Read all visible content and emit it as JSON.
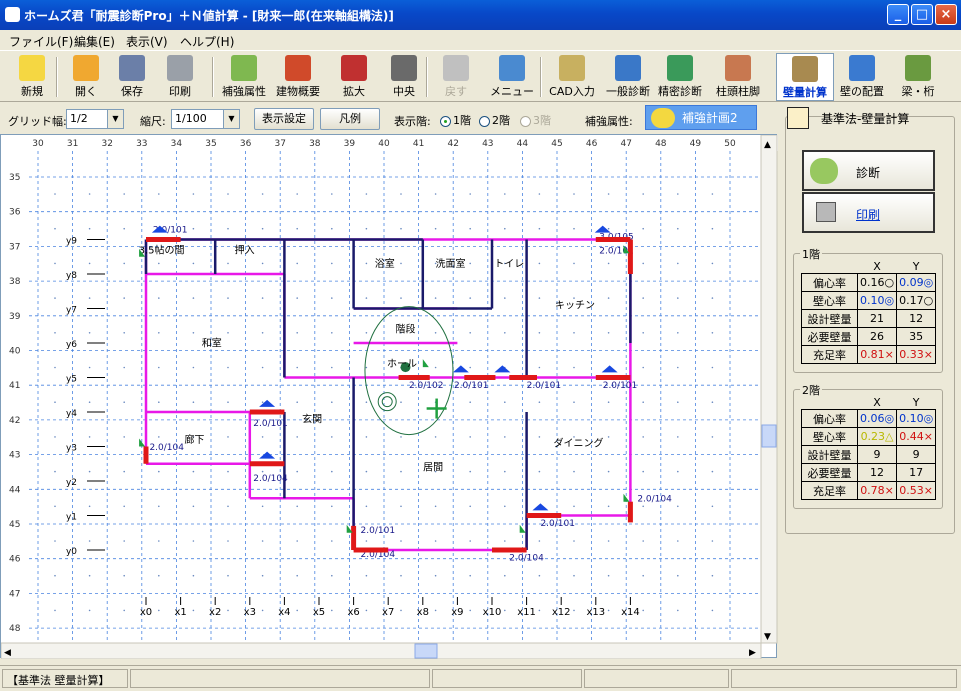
{
  "window": {
    "title": "ホームズ君「耐震診断Pro」＋Ｎ値計算 - [財来一郎(在来軸組構法)]"
  },
  "menu": [
    "ファイル(F)",
    "編集(E)",
    "表示(V)",
    "ヘルプ(H)"
  ],
  "toolbar": [
    {
      "label": "新規",
      "icon": "new-icon"
    },
    {
      "label": "開く",
      "icon": "open-folder-icon"
    },
    {
      "label": "保存",
      "icon": "save-icon"
    },
    {
      "label": "印刷",
      "icon": "print-icon"
    },
    {
      "label": "補強属性",
      "icon": "reinforce-icon"
    },
    {
      "label": "建物概要",
      "icon": "house-icon"
    },
    {
      "label": "拡大",
      "icon": "zoom-in-icon"
    },
    {
      "label": "中央",
      "icon": "center-icon"
    },
    {
      "label": "戻す",
      "icon": "undo-icon"
    },
    {
      "label": "メニュー",
      "icon": "menu-door-icon"
    },
    {
      "label": "CAD入力",
      "icon": "cad-icon"
    },
    {
      "label": "一般診断",
      "icon": "general-diagnosis-icon"
    },
    {
      "label": "精密診断",
      "icon": "precise-diagnosis-icon"
    },
    {
      "label": "柱頭柱脚",
      "icon": "column-icon"
    },
    {
      "label": "壁量計算",
      "icon": "wall-calc-icon"
    },
    {
      "label": "壁の配置",
      "icon": "wall-layout-icon"
    },
    {
      "label": "梁・桁",
      "icon": "beam-icon"
    }
  ],
  "options": {
    "grid_label": "グリッド幅:",
    "grid_value": "1/2",
    "scale_label": "縮尺:",
    "scale_value": "1/100",
    "display_settings": "表示設定",
    "legend": "凡例",
    "floor_label": "表示階:",
    "floor1": "1階",
    "floor2": "2階",
    "floor3": "3階",
    "reinforce_label": "補強属性:",
    "reinforce_plan": "補強計画2"
  },
  "side": {
    "group_title": "基準法-壁量計算",
    "diagnose": "診断",
    "print": "印刷",
    "col_x": "X",
    "col_y": "Y",
    "floor1": {
      "title": "1階",
      "rows": [
        {
          "label": "偏心率",
          "x": "0.16○",
          "y": "0.09◎",
          "xc": "#000",
          "yc": "#0033cc"
        },
        {
          "label": "壁心率",
          "x": "0.10◎",
          "y": "0.17○",
          "xc": "#0033cc",
          "yc": "#000"
        },
        {
          "label": "設計壁量",
          "x": "21",
          "y": "12",
          "xc": "#000",
          "yc": "#000"
        },
        {
          "label": "必要壁量",
          "x": "26",
          "y": "35",
          "xc": "#000",
          "yc": "#000"
        },
        {
          "label": "充足率",
          "x": "0.81×",
          "y": "0.33×",
          "xc": "#d01010",
          "yc": "#d01010"
        }
      ]
    },
    "floor2": {
      "title": "2階",
      "rows": [
        {
          "label": "偏心率",
          "x": "0.06◎",
          "y": "0.10◎",
          "xc": "#0033cc",
          "yc": "#0033cc"
        },
        {
          "label": "壁心率",
          "x": "0.23△",
          "y": "0.44×",
          "xc": "#b8b800",
          "yc": "#d01010"
        },
        {
          "label": "設計壁量",
          "x": "9",
          "y": "9",
          "xc": "#000",
          "yc": "#000"
        },
        {
          "label": "必要壁量",
          "x": "12",
          "y": "17",
          "xc": "#000",
          "yc": "#000"
        },
        {
          "label": "充足率",
          "x": "0.78×",
          "y": "0.53×",
          "xc": "#d01010",
          "yc": "#d01010"
        }
      ]
    }
  },
  "plan": {
    "top_ruler": [
      "30",
      "31",
      "32",
      "33",
      "34",
      "35",
      "36",
      "37",
      "38",
      "39",
      "40",
      "41",
      "42",
      "43",
      "44",
      "45",
      "46",
      "47",
      "48",
      "49",
      "50"
    ],
    "left_ruler": [
      "35",
      "36",
      "37",
      "38",
      "39",
      "40",
      "41",
      "42",
      "43",
      "44",
      "45",
      "46",
      "47",
      "48"
    ],
    "x_axis": [
      "x0",
      "x1",
      "x2",
      "x3",
      "x4",
      "x5",
      "x6",
      "x7",
      "x8",
      "x9",
      "x10",
      "x11",
      "x12",
      "x13",
      "x14"
    ],
    "y_axis": [
      "y0",
      "y1",
      "y2",
      "y3",
      "y4",
      "y5",
      "y6",
      "y7",
      "y8",
      "y9"
    ],
    "rooms": [
      "3.5帖の間",
      "押入",
      "浴室",
      "洗面室",
      "トイレ",
      "キッチン",
      "和室",
      "階段",
      "ホール",
      "玄関",
      "廊下",
      "居間",
      "ダイニング"
    ],
    "wall_labels": [
      "2.0/101",
      "3.0/105",
      "2.0/101",
      "2.0/104",
      "2.0/102",
      "2.0/101",
      "2.0/101",
      "2.0/101",
      "2.0/104",
      "2.0/101",
      "2.0/104",
      "2.0/101",
      "2.0/101",
      "2.0/104",
      "2.0/104"
    ]
  },
  "status": {
    "mode": "【基準法 壁量計算】"
  }
}
